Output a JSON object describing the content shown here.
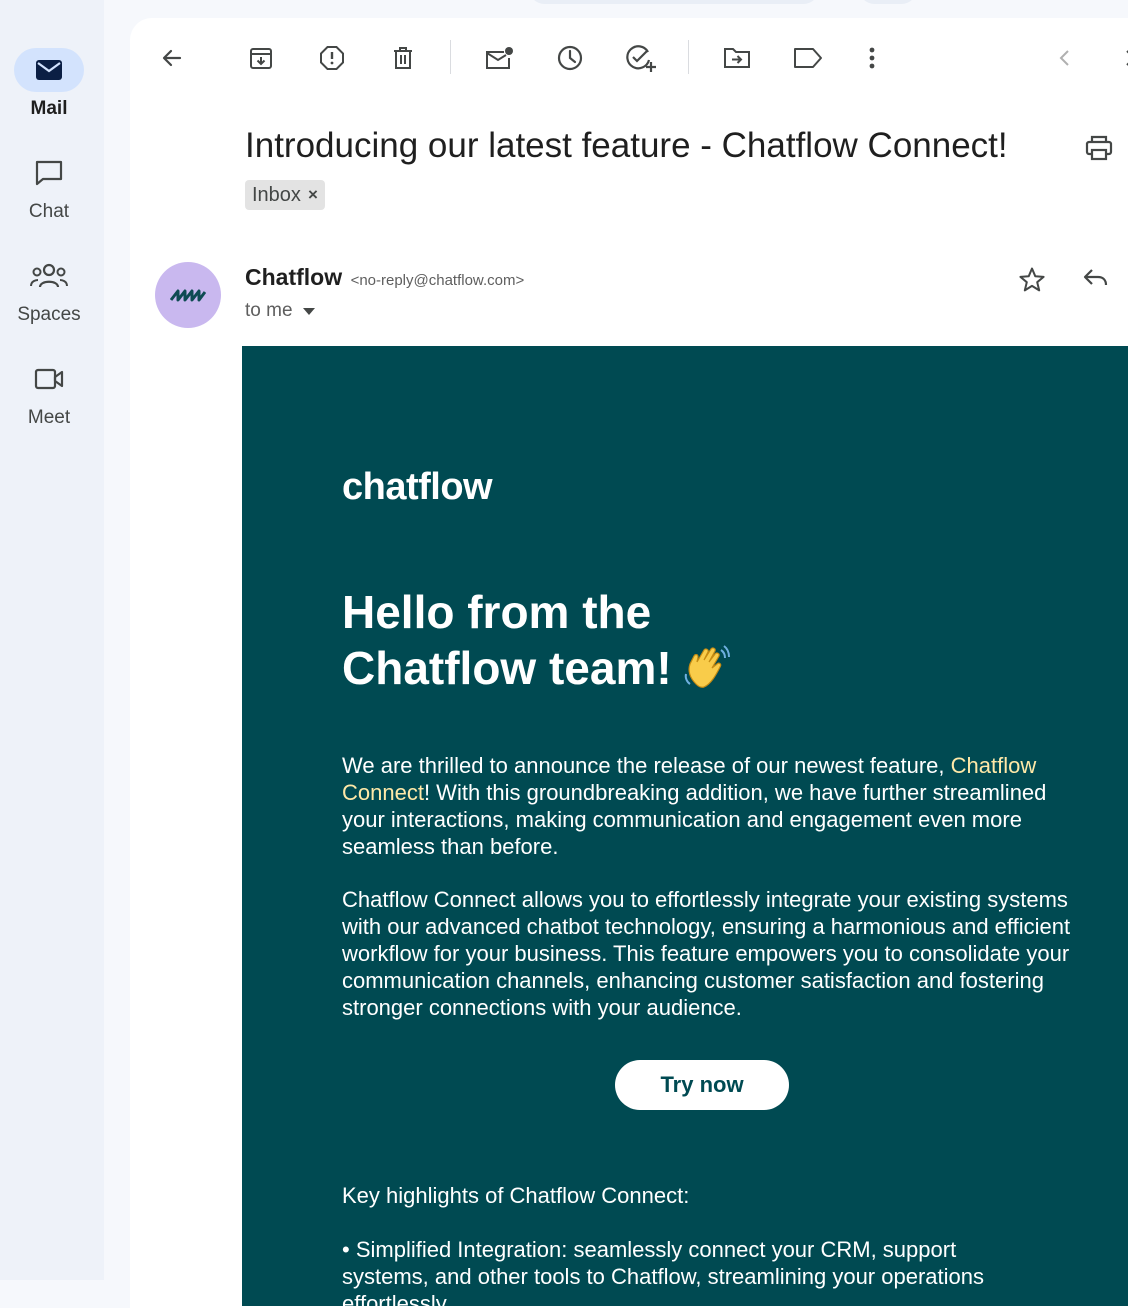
{
  "nav": {
    "items": [
      {
        "label": "Mail",
        "icon": "mail-icon",
        "active": true
      },
      {
        "label": "Chat",
        "icon": "chat-icon"
      },
      {
        "label": "Spaces",
        "icon": "spaces-icon"
      },
      {
        "label": "Meet",
        "icon": "meet-icon"
      }
    ]
  },
  "toolbar": {
    "icons": [
      "back-icon",
      "archive-icon",
      "report-spam-icon",
      "delete-icon",
      "mark-unread-icon",
      "snooze-icon",
      "add-task-icon",
      "move-to-icon",
      "label-icon",
      "more-icon",
      "prev-icon",
      "next-icon"
    ]
  },
  "message": {
    "subject": "Introducing our latest feature - Chatflow Connect!",
    "label_chip": "Inbox",
    "chip_close": "×",
    "sender_name": "Chatflow",
    "sender_email": "<no-reply@chatflow.com>",
    "recipient_text": "to me"
  },
  "email": {
    "brand": "chatflow",
    "headline_line1": "Hello from the",
    "headline_line2": "Chatflow team!",
    "intro_before": "We are thrilled to announce the release of our newest feature,",
    "intro_highlight": "Chatflow Connect",
    "intro_after": "! With this groundbreaking addition, we have further streamlined your interactions, making communication  and engagement even more seamless than before.",
    "paragraph2": "Chatflow Connect allows you to effortlessly integrate your existing systems with our advanced chatbot technology, ensuring a harmonious and efficient workflow for your business. This feature empowers you to consolidate your communication channels, enhancing customer satisfaction and fostering stronger connections with your audience.",
    "cta_label": "Try now",
    "highlights_title": "Key highlights of Chatflow Connect:",
    "bullet1": "•    Simplified Integration: seamlessly connect your CRM, support systems, and other tools to Chatflow, streamlining your operations effortlessly."
  },
  "colors": {
    "email_bg": "#004a52",
    "highlight": "#ffe9a8",
    "avatar_bg": "#c9b8ef",
    "nav_active": "#d3e3fd"
  }
}
